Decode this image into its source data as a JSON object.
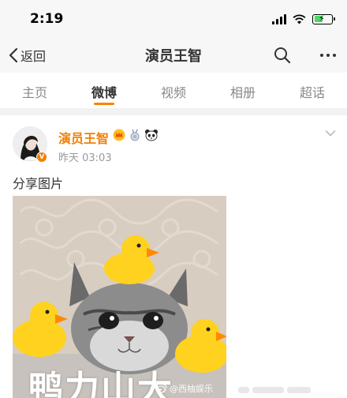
{
  "status_bar": {
    "time": "2:19",
    "battery_color": "#4cd964"
  },
  "nav": {
    "back_label": "返回",
    "title": "演员王智",
    "search_icon": "search-icon",
    "more_icon": "more-icon"
  },
  "tabs": [
    {
      "label": "主页",
      "active": false
    },
    {
      "label": "微博",
      "active": true
    },
    {
      "label": "视频",
      "active": false
    },
    {
      "label": "相册",
      "active": false
    },
    {
      "label": "超话",
      "active": false
    }
  ],
  "accent_color": "#ff8200",
  "post": {
    "author": "演员王智",
    "badges": [
      "crown-badge-icon",
      "medal-badge-icon",
      "panda-badge-icon"
    ],
    "time": "昨天 03:03",
    "text": "分享图片",
    "image": {
      "caption": "鸭力山大",
      "watermark": "@西柚娱乐"
    }
  }
}
